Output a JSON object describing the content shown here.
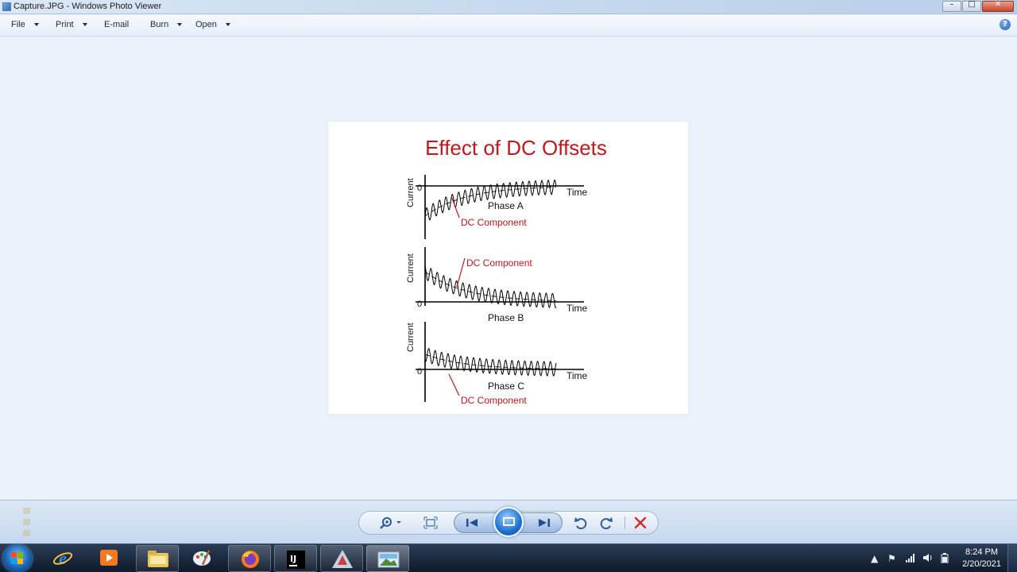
{
  "window": {
    "title": "Capture.JPG - Windows Photo Viewer",
    "minimize_glyph": "–",
    "maximize_glyph": "□",
    "close_glyph": "✕"
  },
  "menu": {
    "items": [
      {
        "label": "File",
        "has_caret": true
      },
      {
        "label": "Print",
        "has_caret": true
      },
      {
        "label": "E-mail",
        "has_caret": false
      },
      {
        "label": "Burn",
        "has_caret": true
      },
      {
        "label": "Open",
        "has_caret": true
      }
    ],
    "help_glyph": "?"
  },
  "image": {
    "title": "Effect of DC Offsets",
    "title_color": "#c4161c",
    "panels": [
      {
        "phase_label": "Phase A",
        "y_label": "Current",
        "zero_label": "0",
        "time_label": "Time",
        "annotation": "DC Component"
      },
      {
        "phase_label": "Phase B",
        "y_label": "Current",
        "zero_label": "0",
        "time_label": "Time",
        "annotation": "DC Component"
      },
      {
        "phase_label": "Phase C",
        "y_label": "Current",
        "zero_label": "0",
        "time_label": "Time",
        "annotation": "DC Component"
      }
    ]
  },
  "toolbar": {
    "zoom_icon": "zoom-icon",
    "fit_icon": "fit-to-window-icon",
    "previous_icon": "previous-icon",
    "slideshow_icon": "slideshow-icon",
    "next_icon": "next-icon",
    "rotate_ccw_icon": "rotate-counterclockwise-icon",
    "rotate_cw_icon": "rotate-clockwise-icon",
    "delete_icon": "delete-icon",
    "accent_color": "#2c5a9a",
    "delete_color": "#d3282a"
  },
  "taskbar": {
    "time": "8:24 PM",
    "date": "2/20/2021"
  }
}
